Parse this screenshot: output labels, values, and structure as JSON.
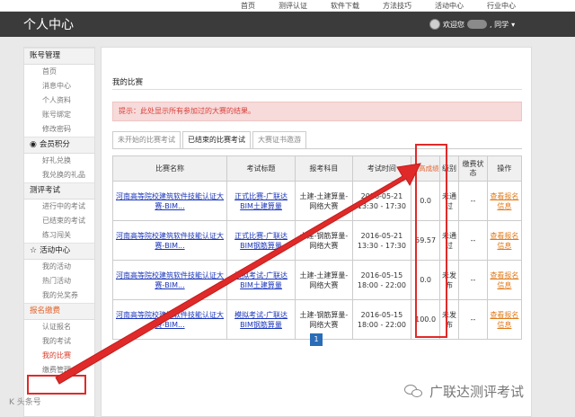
{
  "topnav": {
    "items": [
      "首页",
      "测评认证",
      "软件下载",
      "方法技巧",
      "活动中心",
      "行业中心"
    ]
  },
  "header": {
    "title": "个人中心",
    "welcome": "欢迎您",
    "user_suffix": ", 同学",
    "dropdown": "▾"
  },
  "sidebar": {
    "sections": [
      {
        "title": "账号管理",
        "icon": "",
        "items": [
          "首页",
          "消息中心",
          "个人资料",
          "账号绑定",
          "修改密码"
        ]
      },
      {
        "title": "会员积分",
        "icon": "coin-icon",
        "items": [
          "好礼兑换",
          "我兑换的礼品"
        ]
      },
      {
        "title": "测评考试",
        "icon": "",
        "items": [
          "进行中的考试",
          "已结束的考试",
          "练习闯关"
        ]
      },
      {
        "title": "活动中心",
        "icon": "star-icon",
        "items": [
          "我的活动",
          "热门活动",
          "我的兑奖券"
        ]
      },
      {
        "title": "报名缴费",
        "icon": "",
        "items": [
          "认证报名",
          "我的考试",
          "我的比赛",
          "缴费管理"
        ]
      }
    ],
    "active_item": "我的比赛"
  },
  "main": {
    "page_title": "我的比赛",
    "notice": "提示：此处显示所有参加过的大赛的结果。",
    "tabs": [
      "未开始的比赛考试",
      "已结束的比赛考试",
      "大赛证书邀游"
    ],
    "active_tab": 1,
    "table": {
      "headers": [
        "比赛名称",
        "考试标题",
        "报考科目",
        "考试时间",
        "最高成绩",
        "级别",
        "缴费状态",
        "操作"
      ],
      "rows": [
        {
          "name": "河南高等院校建筑软件技能认证大赛-BIM...",
          "exam_title": "正式比赛-广联达BIM土建算量",
          "subject": "土建-土建算量-网络大赛",
          "time": "2016-05-21 13:30 - 17:30",
          "score": "0.0",
          "level": "未通过",
          "pay_status": "--",
          "action": "查看报名信息"
        },
        {
          "name": "河南高等院校建筑软件技能认证大赛-BIM...",
          "exam_title": "正式比赛-广联达BIM钢筋算量",
          "subject": "土建-钢筋算量-网络大赛",
          "time": "2016-05-21 13:30 - 17:30",
          "score": "59.57",
          "level": "未通过",
          "pay_status": "--",
          "action": "查看报名信息"
        },
        {
          "name": "河南高等院校建筑软件技能认证大赛-BIM...",
          "exam_title": "模拟考试-广联达BIM土建算量",
          "subject": "土建-土建算量-网络大赛",
          "time": "2016-05-15 18:00 - 22:00",
          "score": "0.0",
          "level": "未发布",
          "pay_status": "--",
          "action": "查看报名信息"
        },
        {
          "name": "河南高等院校建筑软件技能认证大赛-BIM...",
          "exam_title": "模拟考试-广联达BIM钢筋算量",
          "subject": "土建-钢筋算量-网络大赛",
          "time": "2016-05-15 18:00 - 22:00",
          "score": "100.0",
          "level": "未发布",
          "pay_status": "--",
          "action": "查看报名信息"
        }
      ]
    },
    "pager": {
      "current": "1"
    }
  },
  "watermark": {
    "text": "广联达测评考试"
  },
  "signature": "K 头条号",
  "colors": {
    "header_bg": "#3b3b3b",
    "accent_red": "#e02a2a",
    "link_blue": "#1a35b8",
    "link_orange": "#e07b1b",
    "notice_bg": "#f7dada"
  }
}
